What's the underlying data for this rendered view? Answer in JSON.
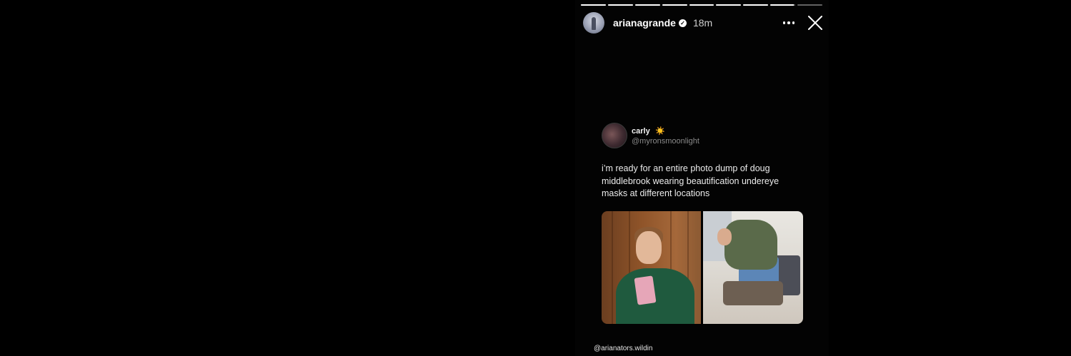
{
  "story": {
    "progress": {
      "segments": [
        1,
        1,
        1,
        1,
        1,
        1,
        1,
        0.95,
        0
      ],
      "active_index": 7
    },
    "header": {
      "username": "arianagrande",
      "verified_icon": "verified-badge-icon",
      "timestamp": "18m",
      "more_icon": "more-options-icon",
      "close_icon": "close-icon"
    },
    "post": {
      "display_name": "carly",
      "name_emoji": "☀️",
      "handle": "@myronsmoonlight",
      "text": "i’m ready for an entire photo dump of doug middlebrook wearing beautification undereye masks at different locations",
      "media": [
        "photo-left",
        "photo-right"
      ]
    },
    "credit": "@arianators.wildin"
  },
  "colors": {
    "background": "#000000",
    "progress_track": "rgba(255,255,255,0.38)",
    "progress_fill": "#ffffff",
    "text_primary": "#ffffff",
    "text_secondary": "#8a8a8a"
  }
}
